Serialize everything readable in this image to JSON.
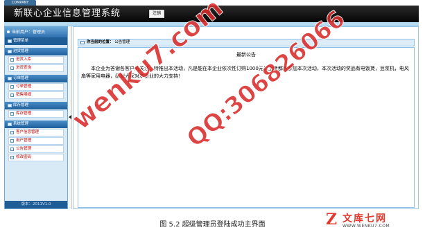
{
  "header": {
    "company_tab": "COMPANY",
    "app_title": "新联心企业信息管理系统",
    "logout_label": "注销"
  },
  "sidebar": {
    "current_user": "当前用户：管理员",
    "menu_title": "管理菜单",
    "groups": [
      {
        "label": "进货管理",
        "items": [
          "进货入库",
          "进货查询"
        ]
      },
      {
        "label": "订单管理",
        "items": [
          "订单管理",
          "销售明细"
        ]
      },
      {
        "label": "库存管理",
        "items": [
          "库存管理"
        ]
      },
      {
        "label": "系统管理",
        "items": [
          "客户信息管理",
          "用户管理",
          "公告管理",
          "修改密码"
        ]
      }
    ],
    "version": "版本：2011V1.0"
  },
  "main": {
    "breadcrumb_label": "你当前的位置：",
    "breadcrumb_value": "公告管理",
    "notice_title": "最新公告",
    "notice_body": "本企业为答谢各客户的关注，特推出本活动，凡是能在本企业依次性订购1000元以上者都可参加本次活动，本次活动的奖品有电饭煲，豆浆机，电风扇等家用电器，感谢大家对本企业的大力支持！"
  },
  "watermarks": {
    "site": "wenku7.com",
    "qq": "QQ:306826066"
  },
  "caption": "图 5.2  超级管理员登陆成功主界面",
  "logo": {
    "text": "文库七网",
    "url": "WWW.WENKU7.COM"
  },
  "colors": {
    "header_bg": "#0a0a0a",
    "sidebar_header": "#2e6fb0",
    "menu_item_text": "#c00000",
    "watermark": "#d92b2b"
  }
}
